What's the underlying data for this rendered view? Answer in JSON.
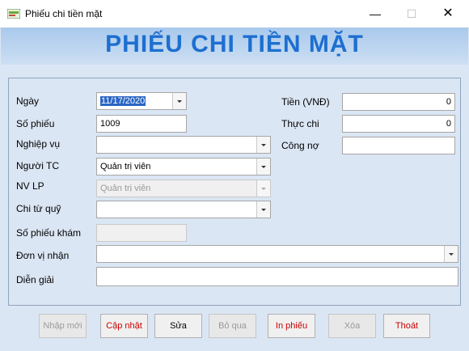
{
  "window": {
    "title": "Phiếu chi tiền mặt",
    "min_glyph": "—",
    "max_glyph": "☐",
    "close_glyph": "✕"
  },
  "heading": "PHIẾU CHI TIỀN MẶT",
  "fields": {
    "ngay": {
      "label": "Ngày",
      "value": "11/17/2020"
    },
    "so_phieu": {
      "label": "Số phiếu",
      "value": "1009"
    },
    "nghiep_vu": {
      "label": "Nghiệp vụ",
      "value": ""
    },
    "nguoi_tc": {
      "label": "Người TC",
      "value": "Quản trị viên"
    },
    "nv_lp": {
      "label": "NV LP",
      "value": "Quản trị viên"
    },
    "chi_tu_quy": {
      "label": "Chi từ quỹ",
      "value": ""
    },
    "so_phieu_kham": {
      "label": "Số phiếu khám",
      "value": ""
    },
    "don_vi_nhan": {
      "label": "Đơn vị nhận",
      "value": ""
    },
    "dien_giai": {
      "label": "Diễn giải",
      "value": ""
    },
    "tien": {
      "label": "Tiền (VNĐ)",
      "value": "0"
    },
    "thuc_chi": {
      "label": "Thực chi",
      "value": "0"
    },
    "cong_no": {
      "label": "Công nợ",
      "value": ""
    }
  },
  "buttons": {
    "nhap_moi": "Nhập mới",
    "cap_nhat": "Cập nhật",
    "sua": "Sửa",
    "bo_qua": "Bỏ qua",
    "in_phieu": "In phiếu",
    "xoa": "Xóa",
    "thoat": "Thoát"
  },
  "colors": {
    "heading": "#1d6fd0",
    "accent_red": "#cc0000",
    "form_bg": "#dbe6f4"
  }
}
